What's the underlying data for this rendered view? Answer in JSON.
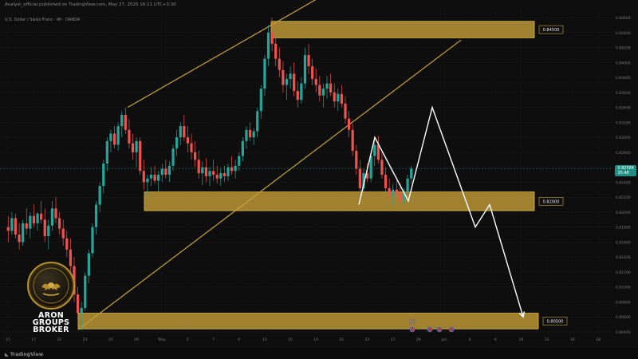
{
  "header": {
    "publisher": "Analyst_official published on TradingView.com, May 27, 2025 16:11 UTC+3:30",
    "symbol": "U.S. Dollar / Swiss Franc · 4h · OANDA"
  },
  "brand": {
    "line1": "ARON",
    "line2": "GROUPS",
    "line3": "BROKER",
    "accent": "#c9a23a"
  },
  "footer": {
    "logo": "TradingView"
  },
  "current_price": {
    "value": "0.82584",
    "sub": "35:48",
    "color": "#1f8f86"
  },
  "chart_data": {
    "type": "candlestick",
    "y_axis": {
      "min": 0.804,
      "max": 0.8475,
      "ticks": [
        "0.84600",
        "0.84400",
        "0.84200",
        "0.84000",
        "0.83800",
        "0.83600",
        "0.83400",
        "0.83200",
        "0.83000",
        "0.82800",
        "0.82600",
        "0.82400",
        "0.82200",
        "0.82000",
        "0.81800",
        "0.81600",
        "0.81400",
        "0.81200",
        "0.81000",
        "0.80800",
        "0.80600",
        "0.80400"
      ],
      "tick_values": [
        0.846,
        0.844,
        0.842,
        0.84,
        0.838,
        0.836,
        0.834,
        0.832,
        0.83,
        0.828,
        0.826,
        0.824,
        0.822,
        0.82,
        0.818,
        0.816,
        0.814,
        0.812,
        0.81,
        0.808,
        0.806,
        0.804
      ]
    },
    "x_axis": {
      "labels": [
        "15",
        "17",
        "21",
        "23",
        "25",
        "29",
        "May",
        "5",
        "7",
        "9",
        "13",
        "15",
        "19",
        "21",
        "23",
        "27",
        "29",
        "Jun",
        "4",
        "6",
        "10",
        "12",
        "16",
        "18"
      ]
    },
    "zones": [
      {
        "name": "resistance",
        "label": "0.84500",
        "top": 0.8455,
        "bottom": 0.8433,
        "x_start": "10",
        "x_end": "10 Jun"
      },
      {
        "name": "middle",
        "label": "0.82000",
        "top": 0.8227,
        "bottom": 0.8202,
        "x_start": "28",
        "x_end": "10 Jun"
      },
      {
        "name": "support",
        "label": "0.80500",
        "top": 0.8065,
        "bottom": 0.8044,
        "x_start": "21",
        "x_end": "10 Jun"
      }
    ],
    "zone_color": "#c9a23a",
    "candle_up_color": "#26a69a",
    "candle_down_color": "#ef5350",
    "candles": [
      [
        0.818,
        0.8195,
        0.816,
        0.8175
      ],
      [
        0.8175,
        0.82,
        0.817,
        0.8192
      ],
      [
        0.8192,
        0.8198,
        0.8165,
        0.817
      ],
      [
        0.817,
        0.8185,
        0.815,
        0.816
      ],
      [
        0.816,
        0.819,
        0.8155,
        0.8185
      ],
      [
        0.8185,
        0.8205,
        0.817,
        0.8178
      ],
      [
        0.8178,
        0.82,
        0.8165,
        0.8195
      ],
      [
        0.8195,
        0.821,
        0.818,
        0.8185
      ],
      [
        0.8185,
        0.82,
        0.8175,
        0.8198
      ],
      [
        0.8198,
        0.8215,
        0.8185,
        0.819
      ],
      [
        0.819,
        0.8205,
        0.816,
        0.8168
      ],
      [
        0.8168,
        0.819,
        0.815,
        0.8182
      ],
      [
        0.8182,
        0.8215,
        0.8175,
        0.8205
      ],
      [
        0.8205,
        0.822,
        0.8185,
        0.8192
      ],
      [
        0.8192,
        0.82,
        0.817,
        0.8178
      ],
      [
        0.8178,
        0.819,
        0.8155,
        0.8165
      ],
      [
        0.8165,
        0.8175,
        0.814,
        0.815
      ],
      [
        0.815,
        0.8165,
        0.812,
        0.8128
      ],
      [
        0.8128,
        0.814,
        0.808,
        0.809
      ],
      [
        0.809,
        0.81,
        0.8055,
        0.8065
      ],
      [
        0.8065,
        0.808,
        0.8042,
        0.8072
      ],
      [
        0.8072,
        0.812,
        0.8068,
        0.8115
      ],
      [
        0.8115,
        0.815,
        0.8105,
        0.8145
      ],
      [
        0.8145,
        0.8185,
        0.814,
        0.818
      ],
      [
        0.818,
        0.8215,
        0.817,
        0.821
      ],
      [
        0.821,
        0.824,
        0.82,
        0.8235
      ],
      [
        0.8235,
        0.827,
        0.8225,
        0.8265
      ],
      [
        0.8265,
        0.83,
        0.8255,
        0.8295
      ],
      [
        0.8295,
        0.831,
        0.828,
        0.8305
      ],
      [
        0.8305,
        0.8315,
        0.8285,
        0.829
      ],
      [
        0.829,
        0.832,
        0.8282,
        0.8315
      ],
      [
        0.8315,
        0.8335,
        0.83,
        0.833
      ],
      [
        0.833,
        0.834,
        0.8305,
        0.831
      ],
      [
        0.831,
        0.8325,
        0.8285,
        0.8292
      ],
      [
        0.8292,
        0.8305,
        0.827,
        0.828
      ],
      [
        0.828,
        0.83,
        0.826,
        0.8295
      ],
      [
        0.8295,
        0.83,
        0.825,
        0.8255
      ],
      [
        0.8255,
        0.827,
        0.823,
        0.824
      ],
      [
        0.824,
        0.825,
        0.8222,
        0.8245
      ],
      [
        0.8245,
        0.826,
        0.8235,
        0.825
      ],
      [
        0.825,
        0.8262,
        0.8238,
        0.8242
      ],
      [
        0.8242,
        0.8255,
        0.8228,
        0.825
      ],
      [
        0.825,
        0.8265,
        0.824,
        0.8258
      ],
      [
        0.8258,
        0.827,
        0.8245,
        0.825
      ],
      [
        0.825,
        0.8268,
        0.824,
        0.8262
      ],
      [
        0.8262,
        0.829,
        0.8255,
        0.8285
      ],
      [
        0.8285,
        0.831,
        0.8275,
        0.83
      ],
      [
        0.83,
        0.832,
        0.829,
        0.8315
      ],
      [
        0.8315,
        0.833,
        0.8295,
        0.83
      ],
      [
        0.83,
        0.8315,
        0.828,
        0.8292
      ],
      [
        0.8292,
        0.8305,
        0.827,
        0.828
      ],
      [
        0.828,
        0.8295,
        0.826,
        0.827
      ],
      [
        0.827,
        0.8282,
        0.8245,
        0.8252
      ],
      [
        0.8252,
        0.8268,
        0.8236,
        0.826
      ],
      [
        0.826,
        0.8272,
        0.824,
        0.8248
      ],
      [
        0.8248,
        0.826,
        0.8235,
        0.8255
      ],
      [
        0.8255,
        0.827,
        0.8242,
        0.825
      ],
      [
        0.825,
        0.8262,
        0.8238,
        0.8245
      ],
      [
        0.8245,
        0.8258,
        0.8235,
        0.8252
      ],
      [
        0.8252,
        0.8262,
        0.824,
        0.8248
      ],
      [
        0.8248,
        0.8265,
        0.8242,
        0.826
      ],
      [
        0.826,
        0.8275,
        0.825,
        0.8255
      ],
      [
        0.8255,
        0.827,
        0.8245,
        0.8262
      ],
      [
        0.8262,
        0.828,
        0.8255,
        0.8275
      ],
      [
        0.8275,
        0.83,
        0.8268,
        0.8295
      ],
      [
        0.8295,
        0.8315,
        0.8285,
        0.831
      ],
      [
        0.831,
        0.832,
        0.8295,
        0.83
      ],
      [
        0.83,
        0.8312,
        0.829,
        0.8308
      ],
      [
        0.8308,
        0.834,
        0.83,
        0.8335
      ],
      [
        0.8335,
        0.837,
        0.8325,
        0.8365
      ],
      [
        0.8365,
        0.841,
        0.8355,
        0.8405
      ],
      [
        0.8405,
        0.845,
        0.8395,
        0.844
      ],
      [
        0.844,
        0.846,
        0.8415,
        0.8425
      ],
      [
        0.8425,
        0.8435,
        0.8395,
        0.8405
      ],
      [
        0.8405,
        0.842,
        0.838,
        0.839
      ],
      [
        0.839,
        0.8402,
        0.836,
        0.837
      ],
      [
        0.837,
        0.8385,
        0.835,
        0.8378
      ],
      [
        0.8378,
        0.8395,
        0.8365,
        0.8385
      ],
      [
        0.8385,
        0.84,
        0.8355,
        0.8362
      ],
      [
        0.8362,
        0.8375,
        0.834,
        0.835
      ],
      [
        0.835,
        0.838,
        0.8345,
        0.8372
      ],
      [
        0.8372,
        0.842,
        0.8365,
        0.841
      ],
      [
        0.841,
        0.8425,
        0.8385,
        0.8395
      ],
      [
        0.8395,
        0.8405,
        0.837,
        0.8378
      ],
      [
        0.8378,
        0.8392,
        0.836,
        0.837
      ],
      [
        0.837,
        0.8382,
        0.8348,
        0.8356
      ],
      [
        0.8356,
        0.8372,
        0.834,
        0.8365
      ],
      [
        0.8365,
        0.8382,
        0.8352,
        0.8372
      ],
      [
        0.8372,
        0.8385,
        0.8355,
        0.836
      ],
      [
        0.836,
        0.8372,
        0.834,
        0.8348
      ],
      [
        0.8348,
        0.8365,
        0.8335,
        0.8358
      ],
      [
        0.8358,
        0.837,
        0.834,
        0.8345
      ],
      [
        0.8345,
        0.8355,
        0.8318,
        0.8325
      ],
      [
        0.8325,
        0.8335,
        0.83,
        0.831
      ],
      [
        0.831,
        0.8318,
        0.8275,
        0.8282
      ],
      [
        0.8282,
        0.829,
        0.825,
        0.8258
      ],
      [
        0.8258,
        0.827,
        0.8225,
        0.8232
      ],
      [
        0.8232,
        0.8258,
        0.8228,
        0.8252
      ],
      [
        0.8252,
        0.8265,
        0.824,
        0.8245
      ],
      [
        0.8245,
        0.828,
        0.824,
        0.8275
      ],
      [
        0.8275,
        0.83,
        0.8262,
        0.829
      ],
      [
        0.829,
        0.8302,
        0.8265,
        0.827
      ],
      [
        0.827,
        0.828,
        0.8245,
        0.825
      ],
      [
        0.825,
        0.826,
        0.8225,
        0.8232
      ],
      [
        0.8232,
        0.8245,
        0.8215,
        0.8222
      ],
      [
        0.8222,
        0.8238,
        0.821,
        0.823
      ],
      [
        0.823,
        0.8242,
        0.8218,
        0.8225
      ],
      [
        0.8225,
        0.8238,
        0.8208,
        0.8215
      ],
      [
        0.8215,
        0.8232,
        0.821,
        0.8228
      ],
      [
        0.8228,
        0.825,
        0.8222,
        0.8245
      ],
      [
        0.8245,
        0.8262,
        0.8238,
        0.8258
      ]
    ],
    "projection_points": [
      [
        "0.82100",
        450
      ],
      [
        "0.83000",
        470
      ],
      [
        "0.82150",
        512
      ],
      [
        "0.83400",
        542
      ],
      [
        "0.81800",
        596
      ],
      [
        "0.82100",
        614
      ],
      [
        "0.80600",
        656
      ]
    ],
    "projection_color": "#ffffff",
    "channel": {
      "color": "#c9a23a",
      "upper_line": [
        [
          0.834,
          160
        ],
        [
          0.8528,
          468
        ]
      ],
      "lower_line": [
        [
          0.8043,
          98
        ],
        [
          0.843,
          578
        ]
      ]
    },
    "event_markers": [
      {
        "x_label": "27",
        "count": 1,
        "labeled": true
      },
      {
        "x_label": "29",
        "count": 3
      }
    ]
  }
}
